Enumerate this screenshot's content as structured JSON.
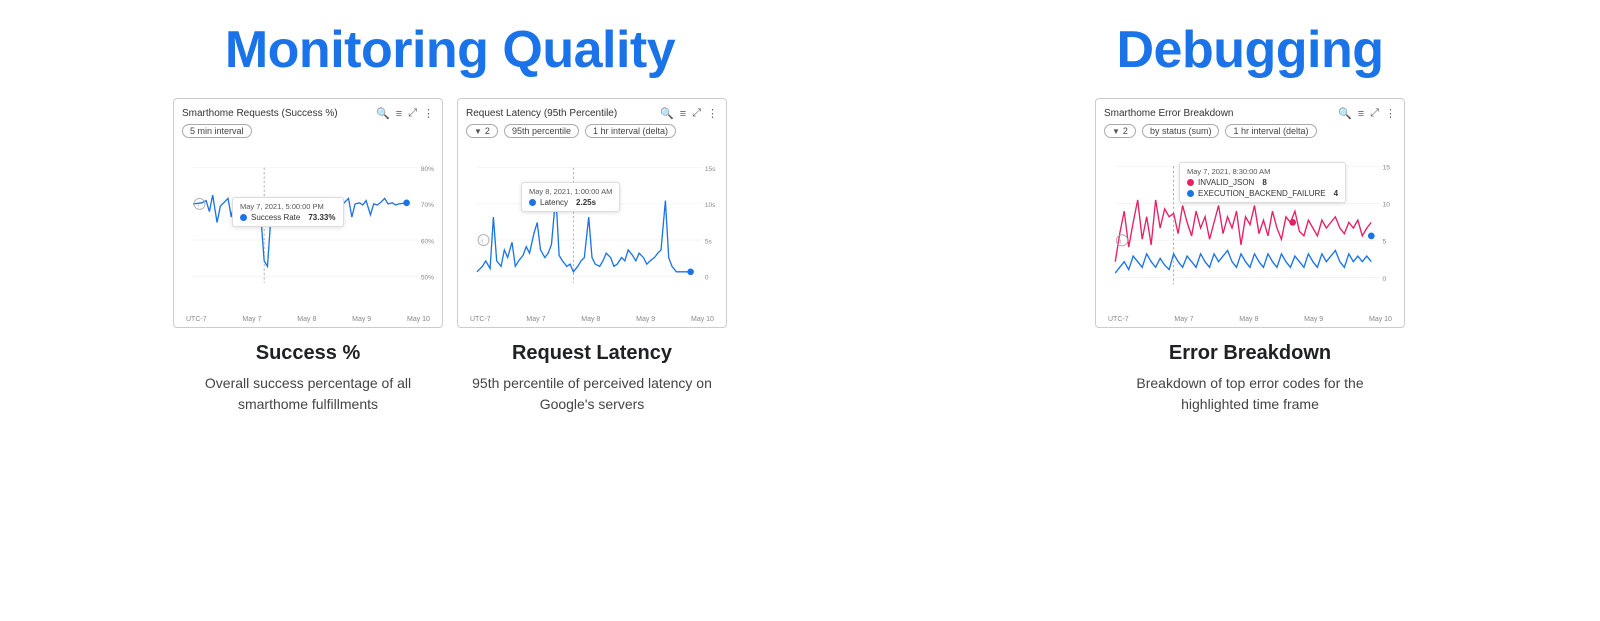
{
  "left_section": {
    "title": "Monitoring Quality",
    "charts": [
      {
        "id": "success-rate",
        "title": "Smarthome Requests (Success %)",
        "filter_chips": [
          "5 min interval"
        ],
        "tooltip": {
          "date": "May 7, 2021, 5:00:00 PM",
          "metric": "Success Rate",
          "value": "73.33%",
          "dot_color": "#1a73e8"
        },
        "y_labels": [
          "80%",
          "70%",
          "60%",
          "50%"
        ],
        "x_labels": [
          "UTC-7",
          "May 7",
          "May 8",
          "May 9",
          "May 10"
        ],
        "metric_title": "Success %",
        "metric_desc": "Overall success percentage of all smarthome fulfillments"
      },
      {
        "id": "request-latency",
        "title": "Request Latency (95th Percentile)",
        "filter_chips": [
          "2",
          "95th percentile",
          "1 hr interval (delta)"
        ],
        "tooltip": {
          "date": "May 8, 2021, 1:00:00 AM",
          "metric": "Latency",
          "value": "2.25s",
          "dot_color": "#1a73e8"
        },
        "y_labels": [
          "15s",
          "10s",
          "5s",
          "0"
        ],
        "x_labels": [
          "UTC-7",
          "May 7",
          "May 8",
          "May 9",
          "May 10"
        ],
        "metric_title": "Request Latency",
        "metric_desc": "95th percentile of perceived latency on Google's servers"
      }
    ]
  },
  "right_section": {
    "title": "Debugging",
    "chart": {
      "id": "error-breakdown",
      "title": "Smarthome Error Breakdown",
      "filter_chips": [
        "2",
        "by status (sum)",
        "1 hr interval (delta)"
      ],
      "tooltip": {
        "date": "May 7, 2021, 8:30:00 AM",
        "rows": [
          {
            "label": "INVALID_JSON",
            "value": "8",
            "dot_color": "#e91e63"
          },
          {
            "label": "EXECUTION_BACKEND_FAILURE",
            "value": "4",
            "dot_color": "#1a73e8"
          }
        ]
      },
      "y_labels": [
        "15",
        "10",
        "5",
        "0"
      ],
      "x_labels": [
        "UTC-7",
        "May 7",
        "May 8",
        "May 9",
        "May 10"
      ],
      "metric_title": "Error Breakdown",
      "metric_desc": "Breakdown of top error codes for the highlighted time frame"
    }
  },
  "icons": {
    "search": "🔍",
    "legend": "≡",
    "expand": "⤢",
    "more": "⋮",
    "filter": "▼"
  }
}
